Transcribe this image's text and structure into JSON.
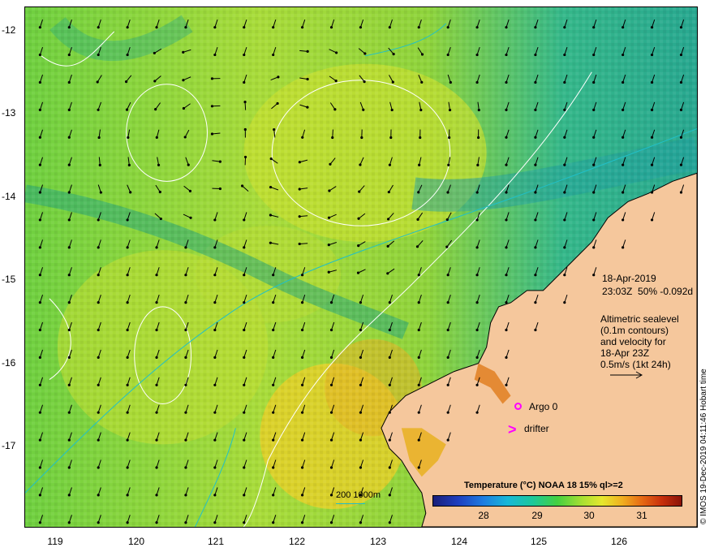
{
  "axes": {
    "y_labels": [
      "-12",
      "-13",
      "-14",
      "-15",
      "-16",
      "-17"
    ],
    "x_labels": [
      "119",
      "120",
      "121",
      "122",
      "123",
      "124",
      "125",
      "126"
    ]
  },
  "timestamp": {
    "date": "18-Apr-2019",
    "time_line": "23:03Z  50% -0.092d"
  },
  "altimetry_note": {
    "line1": "Altimetric sealevel",
    "line2": "(0.1m contours)",
    "line3": "and velocity for",
    "line4": "18-Apr 23Z",
    "line5": "0.5m/s (1kt 24h)"
  },
  "markers": {
    "argo_label": "Argo 0",
    "drifter_label": "drifter",
    "drifter_symbol": ">"
  },
  "legend": {
    "title": "Temperature (°C) NOAA 18 15% ql>=2",
    "ticks": [
      "28",
      "29",
      "30",
      "31"
    ]
  },
  "scale": {
    "label": "200  1000m"
  },
  "credit": "© IMOS 19-Dec-2019 04:11:46 Hobart time",
  "colors": {
    "land": "#f5c79c",
    "warm_sea": "#c8e028",
    "cool_sea": "#2fb886",
    "contour": "#ffffff",
    "isobath": "#20c0c8",
    "marker": "#ff00ff"
  }
}
